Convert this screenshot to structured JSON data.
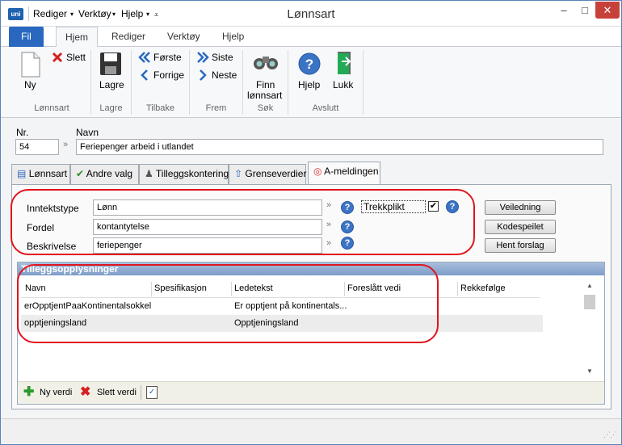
{
  "window": {
    "title": "Lønnsart",
    "logo": "uni",
    "qat": [
      "Rediger",
      "Verktøy",
      "Hjelp"
    ],
    "minimize": "–",
    "maximize": "□",
    "close": "✕"
  },
  "ribbon_tabs": {
    "file": "Fil",
    "tabs": [
      "Hjem",
      "Rediger",
      "Verktøy",
      "Hjelp"
    ]
  },
  "ribbon": {
    "ny": "Ny",
    "slett": "Slett",
    "lagre": "Lagre",
    "forste": "Første",
    "forrige": "Forrige",
    "siste": "Siste",
    "neste": "Neste",
    "finn": "Finn\nlønnsart",
    "finn1": "Finn",
    "finn2": "lønnsart",
    "hjelp": "Hjelp",
    "lukk": "Lukk",
    "groups": {
      "lonnsart": "Lønnsart",
      "lagre": "Lagre",
      "tilbake": "Tilbake",
      "frem": "Frem",
      "sok": "Søk",
      "avslutt": "Avslutt"
    }
  },
  "form": {
    "nr_label": "Nr.",
    "nr_value": "54",
    "navn_label": "Navn",
    "navn_value": "Feriepenger arbeid i utlandet",
    "arrow": "»"
  },
  "tabs": [
    "Lønnsart",
    "Andre valg",
    "Tilleggskontering",
    "Grenseverdier",
    "A-meldingen"
  ],
  "ameld": {
    "inntektstype_label": "Inntektstype",
    "inntektstype_value": "Lønn",
    "fordel_label": "Fordel",
    "fordel_value": "kontantytelse",
    "beskrivelse_label": "Beskrivelse",
    "beskrivelse_value": "feriepenger",
    "trekkplikt_label": "Trekkplikt",
    "trekkplikt_checked": true,
    "veiledning": "Veiledning",
    "kodespeilet": "Kodespeilet",
    "hent_forslag": "Hent forslag"
  },
  "grid": {
    "title": "Tilleggsopplysninger",
    "columns": [
      "Navn",
      "Spesifikasjon",
      "Ledetekst",
      "Foreslått vedi",
      "Rekkefølge"
    ],
    "rows": [
      {
        "navn": "erOpptjentPaaKontinentalsokkel",
        "spesifikasjon": "",
        "ledetekst": "Er opptjent på kontinentals...",
        "foreslatt": "",
        "rekkefolge": ""
      },
      {
        "navn": "opptjeningsland",
        "spesifikasjon": "",
        "ledetekst": "Opptjeningsland",
        "foreslatt": "",
        "rekkefolge": ""
      }
    ],
    "ny_verdi": "Ny verdi",
    "slett_verdi": "Slett verdi"
  },
  "colors": {
    "accent": "#2a68c0",
    "annotation": "#e0141e"
  }
}
